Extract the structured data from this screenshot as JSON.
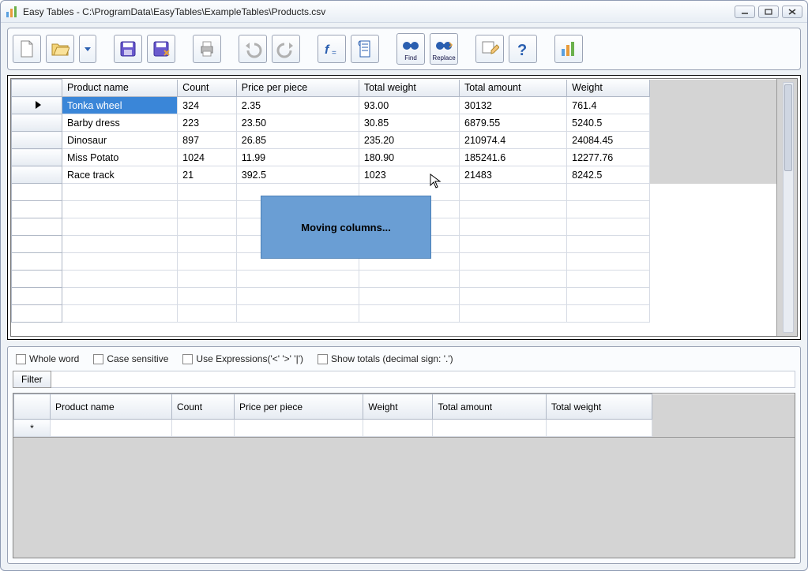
{
  "titlebar": {
    "app_name": "Easy Tables",
    "path": "C:\\ProgramData\\EasyTables\\ExampleTables\\Products.csv"
  },
  "toolbar": {
    "find_label": "Find",
    "replace_label": "Replace"
  },
  "grid": {
    "headers": [
      "Product name",
      "Count",
      "Price per piece",
      "Total weight",
      "Total amount",
      "Weight"
    ],
    "rows": [
      {
        "cells": [
          "Tonka wheel",
          "324",
          "2.35",
          "93.00",
          "30132",
          "761.4"
        ],
        "selected_first": true,
        "marker": true
      },
      {
        "cells": [
          "Barby dress",
          "223",
          "23.50",
          "30.85",
          "6879.55",
          "5240.5"
        ]
      },
      {
        "cells": [
          "Dinosaur",
          "897",
          "26.85",
          "235.20",
          "210974.4",
          "24084.45"
        ]
      },
      {
        "cells": [
          "Miss Potato",
          "1024",
          "11.99",
          "180.90",
          "185241.6",
          "12277.76"
        ]
      },
      {
        "cells": [
          "Race track",
          "21",
          "392.5",
          "1023",
          "21483",
          "8242.5"
        ]
      }
    ],
    "empty_rows": 8
  },
  "overlay": {
    "text": "Moving columns..."
  },
  "filter": {
    "opts": {
      "whole_word": "Whole word",
      "case_sensitive": "Case sensitive",
      "use_expr": "Use Expressions('<' '>' '|')",
      "show_totals": "Show totals (decimal sign: '.')"
    },
    "button": "Filter",
    "headers": [
      "Product name",
      "Count",
      "Price per piece",
      "Weight",
      "Total amount",
      "Total weight"
    ],
    "new_row_marker": "*"
  }
}
